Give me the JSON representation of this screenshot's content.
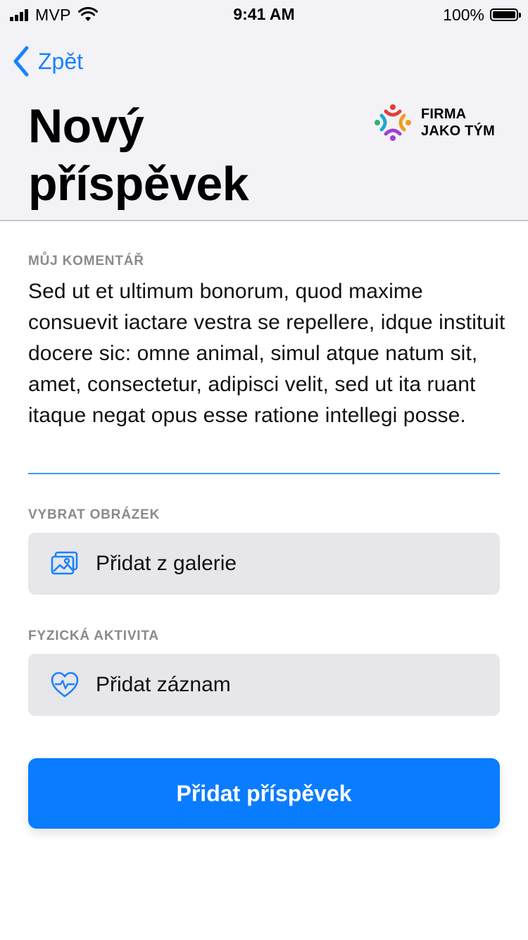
{
  "status_bar": {
    "carrier": "MVP",
    "time": "9:41 AM",
    "battery": "100%"
  },
  "nav": {
    "back_label": "Zpět"
  },
  "header": {
    "title_line1": "Nový",
    "title_line2": "příspěvek",
    "logo_line1": "FIRMA",
    "logo_line2": "JAKO TÝM"
  },
  "comment": {
    "label": "MŮJ KOMENTÁŘ",
    "value": "Sed ut et ultimum bonorum, quod maxime consuevit iactare vestra se repellere, idque instituit docere sic: omne animal, simul atque natum sit, amet, consectetur, adipisci velit, sed ut ita ruant itaque negat opus esse ratione intellegi posse."
  },
  "image": {
    "label": "VYBRAT OBRÁZEK",
    "action": "Přidat z galerie",
    "icon": "gallery-icon"
  },
  "activity": {
    "label": "FYZICKÁ AKTIVITA",
    "action": "Přidat záznam",
    "icon": "heart-pulse-icon"
  },
  "submit": {
    "label": "Přidat příspěvek"
  },
  "colors": {
    "accent": "#0a7cff",
    "link": "#1a82fb",
    "header_bg": "#f2f2f7",
    "row_bg": "#e6e6eb"
  }
}
